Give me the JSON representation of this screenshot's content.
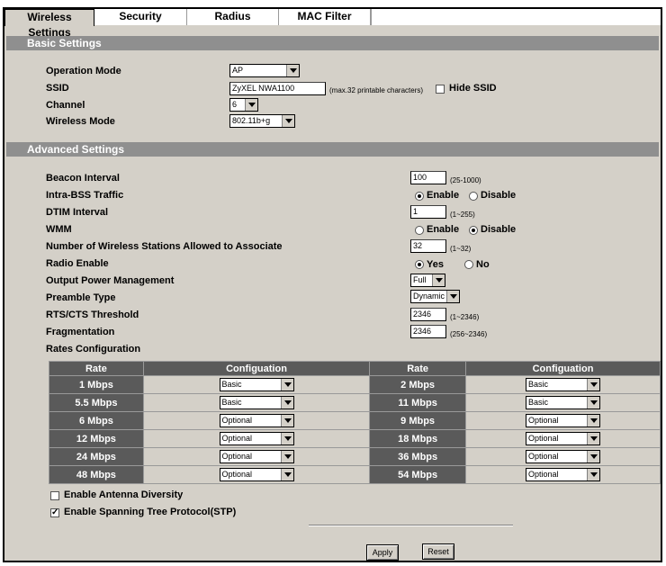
{
  "tabs": [
    "Wireless Settings",
    "Security",
    "Radius",
    "MAC Filter"
  ],
  "basic": {
    "title": "Basic Settings",
    "operation_mode_label": "Operation Mode",
    "operation_mode_value": "AP",
    "ssid_label": "SSID",
    "ssid_value": "ZyXEL NWA1100",
    "ssid_hint": "(max.32 printable characters)",
    "hide_ssid_label": "Hide SSID",
    "channel_label": "Channel",
    "channel_value": "6",
    "wireless_mode_label": "Wireless Mode",
    "wireless_mode_value": "802.11b+g"
  },
  "advanced": {
    "title": "Advanced Settings",
    "beacon_label": "Beacon Interval",
    "beacon_value": "100",
    "beacon_hint": "(25-1000)",
    "intra_label": "Intra-BSS Traffic",
    "enable_label": "Enable",
    "disable_label": "Disable",
    "dtim_label": "DTIM Interval",
    "dtim_value": "1",
    "dtim_hint": "(1~255)",
    "wmm_label": "WMM",
    "stations_label": "Number of Wireless Stations Allowed to Associate",
    "stations_value": "32",
    "stations_hint": "(1~32)",
    "radio_label": "Radio Enable",
    "yes_label": "Yes",
    "no_label": "No",
    "power_label": "Output Power Management",
    "power_value": "Full",
    "preamble_label": "Preamble Type",
    "preamble_value": "Dynamic",
    "rts_label": "RTS/CTS Threshold",
    "rts_value": "2346",
    "rts_hint": "(1~2346)",
    "frag_label": "Fragmentation",
    "frag_value": "2346",
    "frag_hint": "(256~2346)",
    "rates_label": "Rates Configuration"
  },
  "rates_table": {
    "headers": [
      "Rate",
      "Configuation",
      "Rate",
      "Configuation"
    ],
    "rows": [
      {
        "rate1": "1 Mbps",
        "conf1": "Basic",
        "rate2": "2 Mbps",
        "conf2": "Basic"
      },
      {
        "rate1": "5.5 Mbps",
        "conf1": "Basic",
        "rate2": "11 Mbps",
        "conf2": "Basic"
      },
      {
        "rate1": "6 Mbps",
        "conf1": "Optional",
        "rate2": "9 Mbps",
        "conf2": "Optional"
      },
      {
        "rate1": "12 Mbps",
        "conf1": "Optional",
        "rate2": "18 Mbps",
        "conf2": "Optional"
      },
      {
        "rate1": "24 Mbps",
        "conf1": "Optional",
        "rate2": "36 Mbps",
        "conf2": "Optional"
      },
      {
        "rate1": "48 Mbps",
        "conf1": "Optional",
        "rate2": "54 Mbps",
        "conf2": "Optional"
      }
    ]
  },
  "antenna_label": "Enable Antenna Diversity",
  "stp_label": "Enable Spanning Tree Protocol(STP)",
  "buttons": {
    "apply": "Apply",
    "reset": "Reset"
  }
}
